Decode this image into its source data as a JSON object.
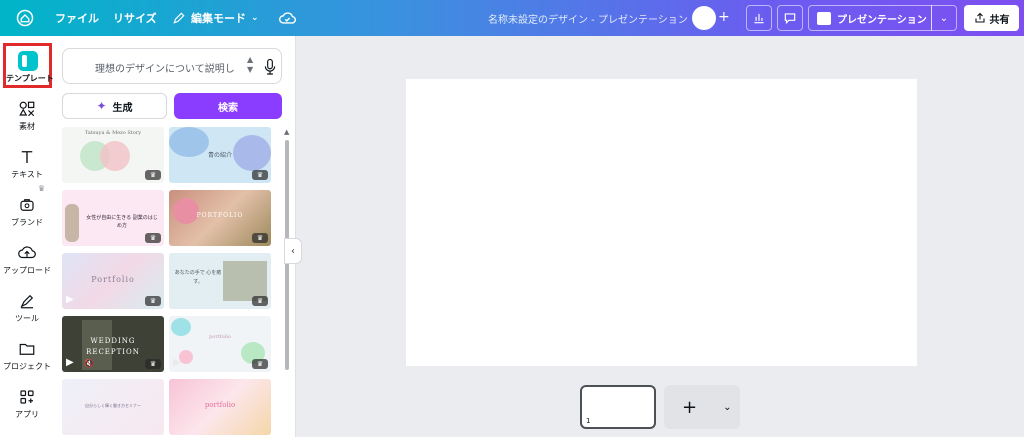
{
  "topbar": {
    "file": "ファイル",
    "resize": "リサイズ",
    "edit_mode": "編集モード",
    "doc_title": "名称未設定のデザイン - プレゼンテーション",
    "present": "プレゼンテーション",
    "share": "共有"
  },
  "rail": {
    "items": [
      {
        "label": "テンプレート",
        "icon": "template-icon"
      },
      {
        "label": "素材",
        "icon": "elements-icon"
      },
      {
        "label": "テキスト",
        "icon": "text-icon"
      },
      {
        "label": "ブランド",
        "icon": "brand-icon"
      },
      {
        "label": "アップロード",
        "icon": "upload-icon"
      },
      {
        "label": "ツール",
        "icon": "tools-icon"
      },
      {
        "label": "プロジェクト",
        "icon": "folder-icon"
      },
      {
        "label": "アプリ",
        "icon": "apps-icon"
      }
    ]
  },
  "panel": {
    "prompt_placeholder": "理想のデザインについて説明し",
    "generate": "生成",
    "search": "検索"
  },
  "templates": [
    {
      "title": "Tatsuya & Mezo Story",
      "bg": "#f4f6f3"
    },
    {
      "title": "青の紹介",
      "bg": "#cfe6f4"
    },
    {
      "title": "女性が自由に生きる 副業のはじめ方",
      "bg": "#fbe8f2"
    },
    {
      "title": "PORTFOLIO",
      "bg": "#d7a78f"
    },
    {
      "title": "Portfolio",
      "bg": "#dfe4f6"
    },
    {
      "title": "あなたの手で 心を癒す。",
      "bg": "#e3eef2"
    },
    {
      "title": "WEDDING RECEPTION",
      "bg": "#3e4236"
    },
    {
      "title": "portfolio",
      "bg": "#f1f4f7"
    },
    {
      "title": "自分らしく輝く働き方セミナー",
      "bg": "#eef0f8"
    },
    {
      "title": "portfolio",
      "bg": "#fbd9e4"
    }
  ],
  "canvas": {
    "page_number": "1"
  },
  "colors": {
    "accent": "#8b3dff",
    "annotation": "#e12a2a"
  }
}
